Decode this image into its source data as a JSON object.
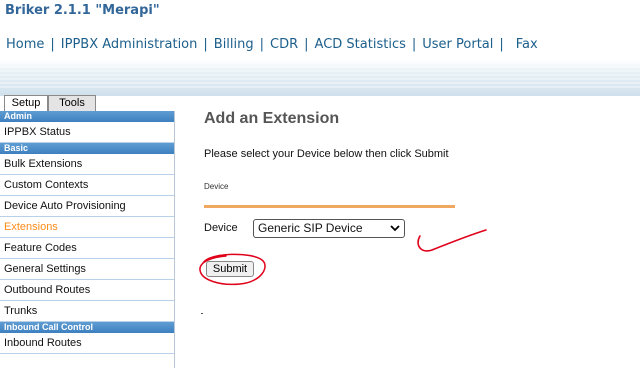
{
  "app": {
    "title": "Briker 2.1.1 \"Merapi\""
  },
  "topnav": {
    "items": [
      {
        "label": "Home"
      },
      {
        "label": "IPPBX Administration"
      },
      {
        "label": "Billing"
      },
      {
        "label": "CDR"
      },
      {
        "label": "ACD Statistics"
      },
      {
        "label": "User Portal"
      },
      {
        "label": "Fax"
      }
    ],
    "separator": "|"
  },
  "tabs": [
    {
      "label": "Setup",
      "active": true
    },
    {
      "label": "Tools",
      "active": false
    }
  ],
  "sidebar": {
    "sections": [
      {
        "header": "Admin",
        "items": [
          {
            "label": "IPPBX Status"
          }
        ]
      },
      {
        "header": "Basic",
        "items": [
          {
            "label": "Bulk Extensions"
          },
          {
            "label": "Custom Contexts"
          },
          {
            "label": "Device Auto Provisioning"
          },
          {
            "label": "Extensions",
            "active": true
          },
          {
            "label": "Feature Codes"
          },
          {
            "label": "General Settings"
          },
          {
            "label": "Outbound Routes"
          },
          {
            "label": "Trunks"
          }
        ]
      },
      {
        "header": "Inbound Call Control",
        "items": [
          {
            "label": "Inbound Routes"
          }
        ]
      }
    ],
    "active_color": "#ff8c1a"
  },
  "main": {
    "title": "Add an Extension",
    "instruction": "Please select your Device below then click Submit",
    "section_label": "Device",
    "device_label": "Device",
    "device_select": {
      "value": "Generic SIP Device",
      "icon": "chevron-down-icon"
    },
    "submit_label": "Submit"
  },
  "colors": {
    "title_blue": "#336699",
    "nav_blue": "#1c5f8c",
    "orange_rule": "#f0a860",
    "annotation_red": "#e0001a"
  }
}
